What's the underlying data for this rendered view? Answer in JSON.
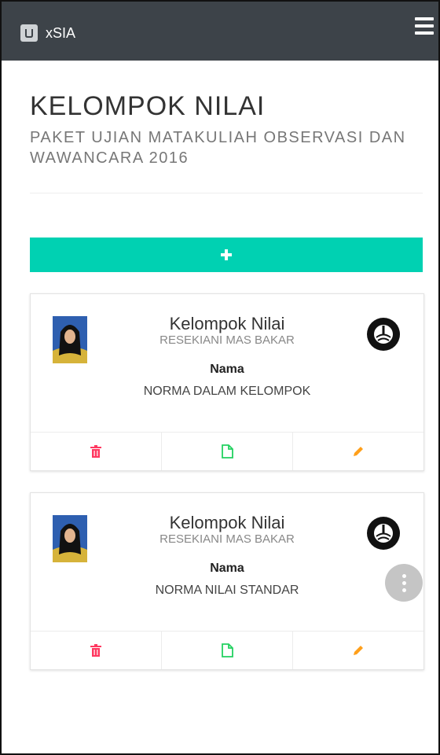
{
  "app": {
    "title": "xSIA",
    "brand_icon": "app-logo-icon",
    "menu_icon": "hamburger-icon"
  },
  "page": {
    "title": "KELOMPOK NILAI",
    "subtitle": "PAKET UJIAN MATAKULIAH OBSERVASI DAN WAWANCARA 2016",
    "add_icon": "plus-icon"
  },
  "colors": {
    "navbar": "#3d4349",
    "accent": "#00d1b2",
    "delete": "#ff3860",
    "view": "#23d160",
    "edit": "#ff9f1a"
  },
  "cards": [
    {
      "title": "Kelompok Nilai",
      "owner": "RESEKIANI MAS BAKAR",
      "label": "Nama",
      "value": "NORMA DALAM KELOMPOK",
      "actions": [
        "trash-icon",
        "file-icon",
        "pencil-icon"
      ]
    },
    {
      "title": "Kelompok Nilai",
      "owner": "RESEKIANI MAS BAKAR",
      "label": "Nama",
      "value": "NORMA NILAI STANDAR",
      "actions": [
        "trash-icon",
        "file-icon",
        "pencil-icon"
      ]
    }
  ]
}
